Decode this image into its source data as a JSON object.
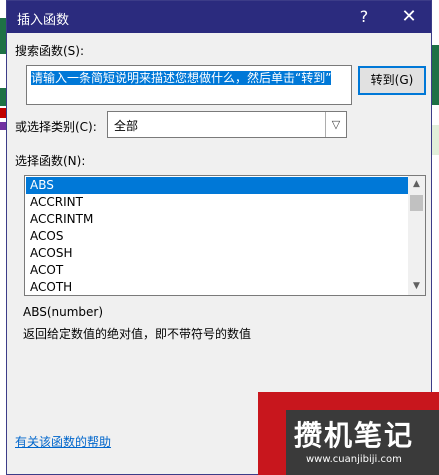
{
  "dialog": {
    "title": "插入函数",
    "help_glyph": "?",
    "close_glyph": "✕",
    "search_label": "搜索函数(S):",
    "search_value": "请输入一条简短说明来描述您想做什么，然后单击“转到”",
    "go_button": "转到(G)",
    "category_label": "或选择类别(C):",
    "category_value": "全部",
    "function_list_label": "选择函数(N):",
    "functions": [
      "ABS",
      "ACCRINT",
      "ACCRINTM",
      "ACOS",
      "ACOSH",
      "ACOT",
      "ACOTH"
    ],
    "selected_function": "ABS",
    "syntax": "ABS(number)",
    "description": "返回给定数值的绝对值，即不带符号的数值",
    "help_link": "有关该函数的帮助"
  },
  "watermark": {
    "text": "攒机笔记",
    "url": "www.cuanjibiji.com"
  },
  "icons": {
    "dropdown": "chevron-down-icon",
    "scroll_up": "scroll-up-icon",
    "scroll_down": "scroll-down-icon"
  }
}
